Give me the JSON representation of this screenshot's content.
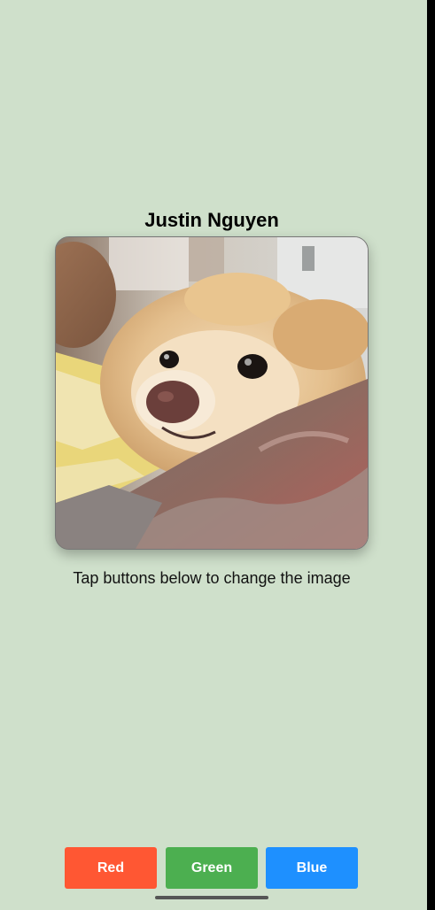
{
  "app": {
    "background_color": "#cfe0cb"
  },
  "profile": {
    "name": "Justin Nguyen"
  },
  "image": {
    "subject": "pomeranian-dog-photo"
  },
  "caption": {
    "text": "Tap buttons below to change the image"
  },
  "buttons": [
    {
      "label": "Red",
      "color": "#ff5733"
    },
    {
      "label": "Green",
      "color": "#4caf50"
    },
    {
      "label": "Blue",
      "color": "#1e90ff"
    }
  ]
}
